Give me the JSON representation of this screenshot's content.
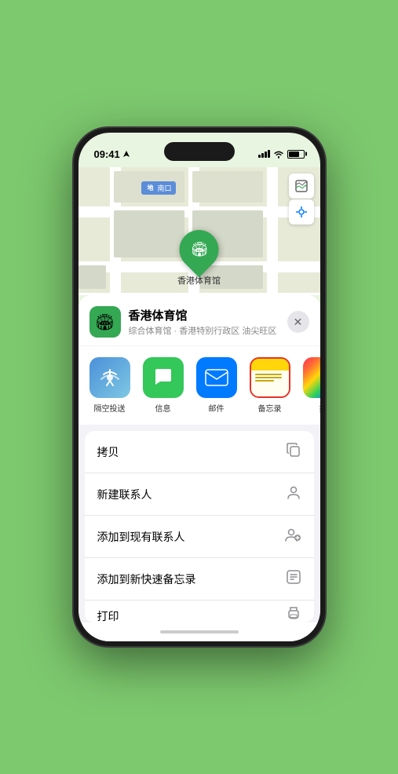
{
  "status_bar": {
    "time": "09:41",
    "location_arrow": "▶"
  },
  "map": {
    "venue_label": "南口",
    "pin_label": "香港体育馆",
    "controls": {
      "map_icon": "🗺",
      "location_icon": "◎"
    }
  },
  "bottom_sheet": {
    "venue_name": "香港体育馆",
    "venue_desc": "综合体育馆 · 香港特别行政区 油尖旺区",
    "close_label": "✕",
    "share_items": [
      {
        "id": "airdrop",
        "label": "隔空投送",
        "icon": "📡"
      },
      {
        "id": "messages",
        "label": "信息",
        "icon": "💬"
      },
      {
        "id": "mail",
        "label": "邮件",
        "icon": "✉"
      },
      {
        "id": "notes",
        "label": "备忘录",
        "icon": "📝"
      },
      {
        "id": "more",
        "label": "推",
        "icon": "..."
      }
    ],
    "actions": [
      {
        "id": "copy",
        "label": "拷贝",
        "icon": "⧉"
      },
      {
        "id": "new-contact",
        "label": "新建联系人",
        "icon": "👤"
      },
      {
        "id": "add-existing",
        "label": "添加到现有联系人",
        "icon": "👤"
      },
      {
        "id": "add-note",
        "label": "添加到新快速备忘录",
        "icon": "⊡"
      },
      {
        "id": "print",
        "label": "打印",
        "icon": "🖨"
      }
    ]
  }
}
